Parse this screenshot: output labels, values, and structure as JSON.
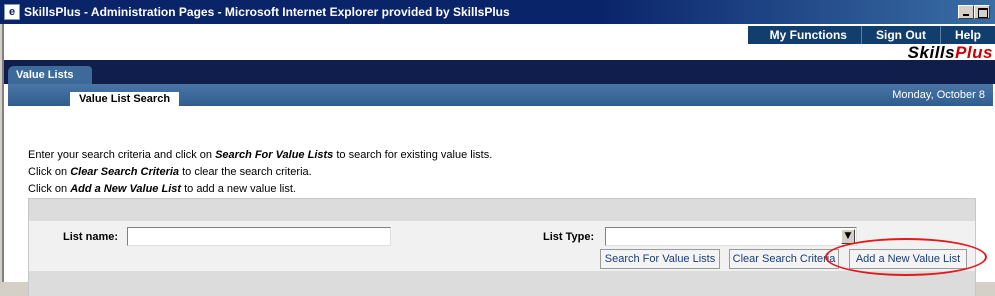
{
  "window": {
    "title": "SkillsPlus - Administration Pages - Microsoft Internet Explorer provided by SkillsPlus",
    "app_icon_glyph": "e"
  },
  "topnav": {
    "items": [
      "My Functions",
      "Sign Out",
      "Help"
    ]
  },
  "logo": {
    "part1": "Skills",
    "part2": "Plus"
  },
  "main_tab": "Value Lists",
  "sub_tab": "Value List Search",
  "date": "Monday, October 8",
  "instructions": [
    {
      "before": "Enter your search criteria and click on ",
      "emph": "Search For Value Lists",
      "after": " to search for existing value lists."
    },
    {
      "before": "Click on ",
      "emph": "Clear Search Criteria",
      "after": " to clear the search criteria."
    },
    {
      "before": "Click on ",
      "emph": "Add a New Value List",
      "after": " to add a new value list."
    }
  ],
  "form": {
    "list_name_label": "List name:",
    "list_name_value": "",
    "list_type_label": "List Type:",
    "list_type_value": ""
  },
  "buttons": {
    "search": "Search For Value Lists",
    "clear": "Clear Search Criteria",
    "add": "Add a New Value List"
  },
  "colors": {
    "titlebar": "#0a246a",
    "nav": "#123e6e",
    "band": "#0f1e4a",
    "highlight": "#e31a1a",
    "logo_accent": "#cc0000"
  }
}
